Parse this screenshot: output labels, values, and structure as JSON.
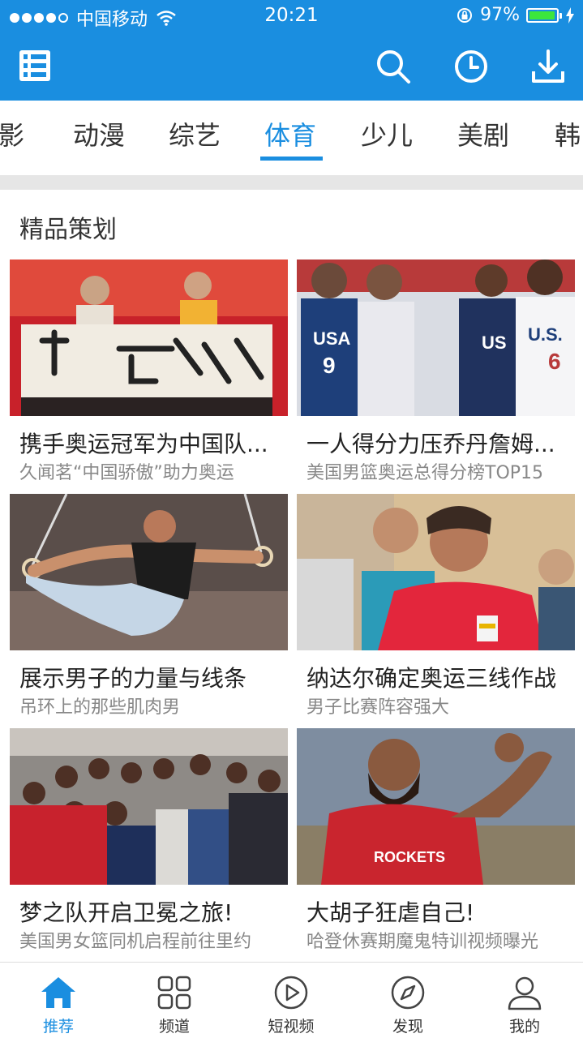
{
  "status": {
    "carrier": "中国移动",
    "time": "20:21",
    "battery": "97%",
    "battery_level": 0.97
  },
  "header": {
    "icons": [
      "library-icon",
      "search-icon",
      "history-icon",
      "download-icon"
    ]
  },
  "tabs": [
    {
      "label": "影"
    },
    {
      "label": "动漫"
    },
    {
      "label": "综艺"
    },
    {
      "label": "体育",
      "active": true
    },
    {
      "label": "少儿"
    },
    {
      "label": "美剧"
    },
    {
      "label": "韩"
    }
  ],
  "section": {
    "title": "精品策划"
  },
  "cards": [
    {
      "title": "携手奥运冠军为中国队...",
      "subtitle": "久闻茗“中国骄傲”助力奥运"
    },
    {
      "title": "一人得分力压乔丹詹姆...",
      "subtitle": "美国男篮奥运总得分榜TOP15"
    },
    {
      "title": "展示男子的力量与线条",
      "subtitle": "吊环上的那些肌肉男"
    },
    {
      "title": "纳达尔确定奥运三线作战",
      "subtitle": "男子比赛阵容强大"
    },
    {
      "title": "梦之队开启卫冕之旅!",
      "subtitle": "美国男女篮同机启程前往里约"
    },
    {
      "title": "大胡子狂虐自己!",
      "subtitle": "哈登休赛期魔鬼特训视频曝光"
    }
  ],
  "bottom_nav": [
    {
      "label": "推荐",
      "icon": "home-icon",
      "active": true
    },
    {
      "label": "频道",
      "icon": "grid-icon"
    },
    {
      "label": "短视频",
      "icon": "play-icon"
    },
    {
      "label": "发现",
      "icon": "compass-icon"
    },
    {
      "label": "我的",
      "icon": "profile-icon"
    }
  ],
  "colors": {
    "accent": "#1a8ee0",
    "battery": "#3ce63c"
  }
}
